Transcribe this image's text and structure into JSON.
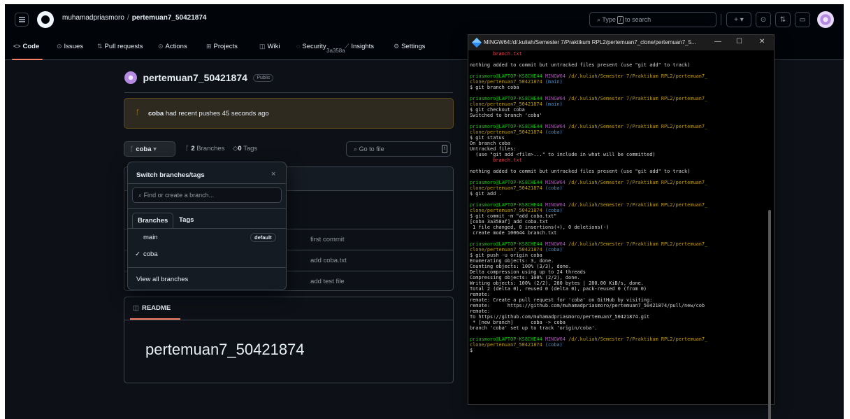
{
  "topbar": {
    "owner": "muhamadpriasmoro",
    "separator": "/",
    "repo": "pertemuan7_50421874",
    "search_prefix": "Type",
    "search_key": "/",
    "search_suffix": "to search",
    "plus": "+ ▾"
  },
  "nav": {
    "code": "Code",
    "issues": "Issues",
    "pull_requests": "Pull requests",
    "actions": "Actions",
    "projects": "Projects",
    "wiki": "Wiki",
    "security": "Security",
    "insights": "Insights",
    "settings": "Settings"
  },
  "repo": {
    "name": "pertemuan7_50421874",
    "visibility": "Public"
  },
  "banner": {
    "branch": "coba",
    "text": "had recent pushes 45 seconds ago"
  },
  "branch_bar": {
    "current": "coba",
    "branches_count": "2",
    "branches_label": "Branches",
    "tags_count": "0",
    "tags_label": "Tags",
    "go_to_file": "Go to file",
    "go_to_file_key": "t"
  },
  "commit_sha": "3a358a",
  "files": [
    {
      "message": "first commit"
    },
    {
      "message": "add coba.txt"
    },
    {
      "message": "add test file"
    }
  ],
  "readme": {
    "tab": "README",
    "title": "pertemuan7_50421874"
  },
  "dropdown": {
    "title": "Switch branches/tags",
    "close": "×",
    "placeholder": "Find or create a branch...",
    "tab_branches": "Branches",
    "tab_tags": "Tags",
    "items": [
      {
        "name": "main",
        "badge": "default",
        "checked": ""
      },
      {
        "name": "coba",
        "badge": "",
        "checked": "✓"
      }
    ],
    "view_all": "View all branches"
  },
  "terminal": {
    "title": "MINGW64:/d/.kuliah/Semester 7/Praktikum RPL2/pertemuan7_clone/pertemuan7_5...",
    "minimize": "—",
    "maximize": "☐",
    "close": "✕",
    "colors": {
      "green": "#16c60c",
      "magenta": "#b148c6",
      "yellow": "#c19c00",
      "cyan": "#3a96dd",
      "red": "#e74856"
    },
    "lines": [
      [
        {
          "t": "        branch.txt",
          "c": "r"
        }
      ],
      [
        {
          "t": ""
        }
      ],
      [
        {
          "t": "nothing added to commit but untracked files present (use \"git add\" to track)"
        }
      ],
      [
        {
          "t": ""
        }
      ],
      [
        {
          "t": "priasmoro@LAPTOP-KS8CHE44 ",
          "c": "g"
        },
        {
          "t": "MINGW64 ",
          "c": "m"
        },
        {
          "t": "/d/.kuliah/Semester 7/Praktikum RPL2/pertemuan7_",
          "c": "y"
        }
      ],
      [
        {
          "t": "clone/pertemuan7_50421874 ",
          "c": "y"
        },
        {
          "t": "(main)",
          "c": "c"
        }
      ],
      [
        {
          "t": "$ git branch coba"
        }
      ],
      [
        {
          "t": ""
        }
      ],
      [
        {
          "t": "priasmoro@LAPTOP-KS8CHE44 ",
          "c": "g"
        },
        {
          "t": "MINGW64 ",
          "c": "m"
        },
        {
          "t": "/d/.kuliah/Semester 7/Praktikum RPL2/pertemuan7_",
          "c": "y"
        }
      ],
      [
        {
          "t": "clone/pertemuan7_50421874 ",
          "c": "y"
        },
        {
          "t": "(main)",
          "c": "c"
        }
      ],
      [
        {
          "t": "$ git checkout coba"
        }
      ],
      [
        {
          "t": "Switched to branch 'coba'"
        }
      ],
      [
        {
          "t": ""
        }
      ],
      [
        {
          "t": "priasmoro@LAPTOP-KS8CHE44 ",
          "c": "g"
        },
        {
          "t": "MINGW64 ",
          "c": "m"
        },
        {
          "t": "/d/.kuliah/Semester 7/Praktikum RPL2/pertemuan7_",
          "c": "y"
        }
      ],
      [
        {
          "t": "clone/pertemuan7_50421874 ",
          "c": "y"
        },
        {
          "t": "(coba)",
          "c": "c"
        }
      ],
      [
        {
          "t": "$ git status"
        }
      ],
      [
        {
          "t": "On branch coba"
        }
      ],
      [
        {
          "t": "Untracked files:"
        }
      ],
      [
        {
          "t": "  (use \"git add <file>...\" to include in what will be committed)"
        }
      ],
      [
        {
          "t": "        branch.txt",
          "c": "r"
        }
      ],
      [
        {
          "t": ""
        }
      ],
      [
        {
          "t": "nothing added to commit but untracked files present (use \"git add\" to track)"
        }
      ],
      [
        {
          "t": ""
        }
      ],
      [
        {
          "t": "priasmoro@LAPTOP-KS8CHE44 ",
          "c": "g"
        },
        {
          "t": "MINGW64 ",
          "c": "m"
        },
        {
          "t": "/d/.kuliah/Semester 7/Praktikum RPL2/pertemuan7_",
          "c": "y"
        }
      ],
      [
        {
          "t": "clone/pertemuan7_50421874 ",
          "c": "y"
        },
        {
          "t": "(coba)",
          "c": "c"
        }
      ],
      [
        {
          "t": "$ git add ."
        }
      ],
      [
        {
          "t": ""
        }
      ],
      [
        {
          "t": "priasmoro@LAPTOP-KS8CHE44 ",
          "c": "g"
        },
        {
          "t": "MINGW64 ",
          "c": "m"
        },
        {
          "t": "/d/.kuliah/Semester 7/Praktikum RPL2/pertemuan7_",
          "c": "y"
        }
      ],
      [
        {
          "t": "clone/pertemuan7_50421874 ",
          "c": "y"
        },
        {
          "t": "(coba)",
          "c": "c"
        }
      ],
      [
        {
          "t": "$ git commit -m \"add coba.txt\""
        }
      ],
      [
        {
          "t": "[coba 3a358af] add coba.txt"
        }
      ],
      [
        {
          "t": " 1 file changed, 0 insertions(+), 0 deletions(-)"
        }
      ],
      [
        {
          "t": " create mode 100644 branch.txt"
        }
      ],
      [
        {
          "t": ""
        }
      ],
      [
        {
          "t": "priasmoro@LAPTOP-KS8CHE44 ",
          "c": "g"
        },
        {
          "t": "MINGW64 ",
          "c": "m"
        },
        {
          "t": "/d/.kuliah/Semester 7/Praktikum RPL2/pertemuan7_",
          "c": "y"
        }
      ],
      [
        {
          "t": "clone/pertemuan7_50421874 ",
          "c": "y"
        },
        {
          "t": "(coba)",
          "c": "c"
        }
      ],
      [
        {
          "t": "$ git push -u origin coba"
        }
      ],
      [
        {
          "t": "Enumerating objects: 3, done."
        }
      ],
      [
        {
          "t": "Counting objects: 100% (3/3), done."
        }
      ],
      [
        {
          "t": "Delta compression using up to 24 threads"
        }
      ],
      [
        {
          "t": "Compressing objects: 100% (2/2), done."
        }
      ],
      [
        {
          "t": "Writing objects: 100% (2/2), 280 bytes | 280.00 KiB/s, done."
        }
      ],
      [
        {
          "t": "Total 2 (delta 0), reused 0 (delta 0), pack-reused 0 (from 0)"
        }
      ],
      [
        {
          "t": "remote:"
        }
      ],
      [
        {
          "t": "remote: Create a pull request for 'coba' on GitHub by visiting:"
        }
      ],
      [
        {
          "t": "remote:      https://github.com/muhamadpriasmoro/pertemuan7_50421874/pull/new/cob"
        }
      ],
      [
        {
          "t": "remote:"
        }
      ],
      [
        {
          "t": "To https://github.com/muhamadpriasmoro/pertemuan7_50421874.git"
        }
      ],
      [
        {
          "t": " * [new branch]      coba -> coba"
        }
      ],
      [
        {
          "t": "branch 'coba' set up to track 'origin/coba'."
        }
      ],
      [
        {
          "t": ""
        }
      ],
      [
        {
          "t": "priasmoro@LAPTOP-KS8CHE44 ",
          "c": "g"
        },
        {
          "t": "MINGW64 ",
          "c": "m"
        },
        {
          "t": "/d/.kuliah/Semester 7/Praktikum RPL2/pertemuan7_",
          "c": "y"
        }
      ],
      [
        {
          "t": "clone/pertemuan7_50421874 ",
          "c": "y"
        },
        {
          "t": "(coba)",
          "c": "c"
        }
      ],
      [
        {
          "t": "$"
        }
      ]
    ]
  }
}
